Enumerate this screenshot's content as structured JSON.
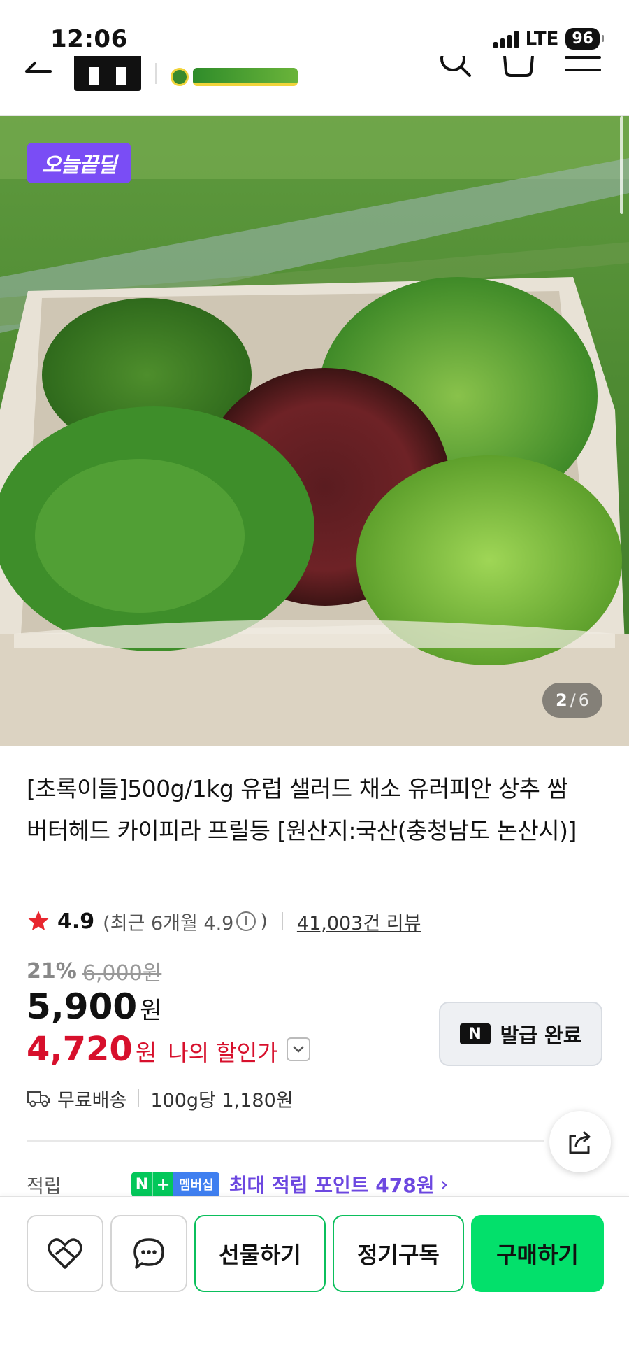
{
  "status_bar": {
    "time": "12:06",
    "network": "LTE",
    "battery": "96"
  },
  "hero": {
    "badge": "오늘끝딜",
    "pager_current": "2",
    "pager_separator": "/",
    "pager_total": "6"
  },
  "product": {
    "title": "[초록이들]500g/1kg 유럽 샐러드 채소 유러피안 상추 쌈 버터헤드 카이피라 프릴등 [원산지:국산(충청남도 논산시)]",
    "rating": "4.9",
    "rating_recent_prefix": "(최근 6개월 4.9",
    "rating_recent_suffix": ")",
    "info_glyph": "i",
    "review_count": "41,003건 리뷰",
    "discount_rate": "21%",
    "original_price": "6,000원",
    "price": "5,900",
    "price_unit": "원",
    "my_price": "4,720",
    "my_price_unit": "원",
    "my_price_label": "나의 할인가"
  },
  "coupon": {
    "n_glyph": "N",
    "label": "발급 완료"
  },
  "shipping": {
    "free_label": "무료배송",
    "unit_price": "100g당 1,180원"
  },
  "points": {
    "label": "적립",
    "badge_n": "N",
    "badge_plus": "+",
    "badge_member": "멤버십",
    "text": "최대 적립 포인트 478원",
    "chevron": "›"
  },
  "actions": {
    "gift": "선물하기",
    "subscribe": "정기구독",
    "buy": "구매하기"
  },
  "colors": {
    "deal_badge": "#7a4df5",
    "my_price_red": "#d7102c",
    "buy_green": "#03e06b",
    "points_purple": "#6c47e0"
  }
}
